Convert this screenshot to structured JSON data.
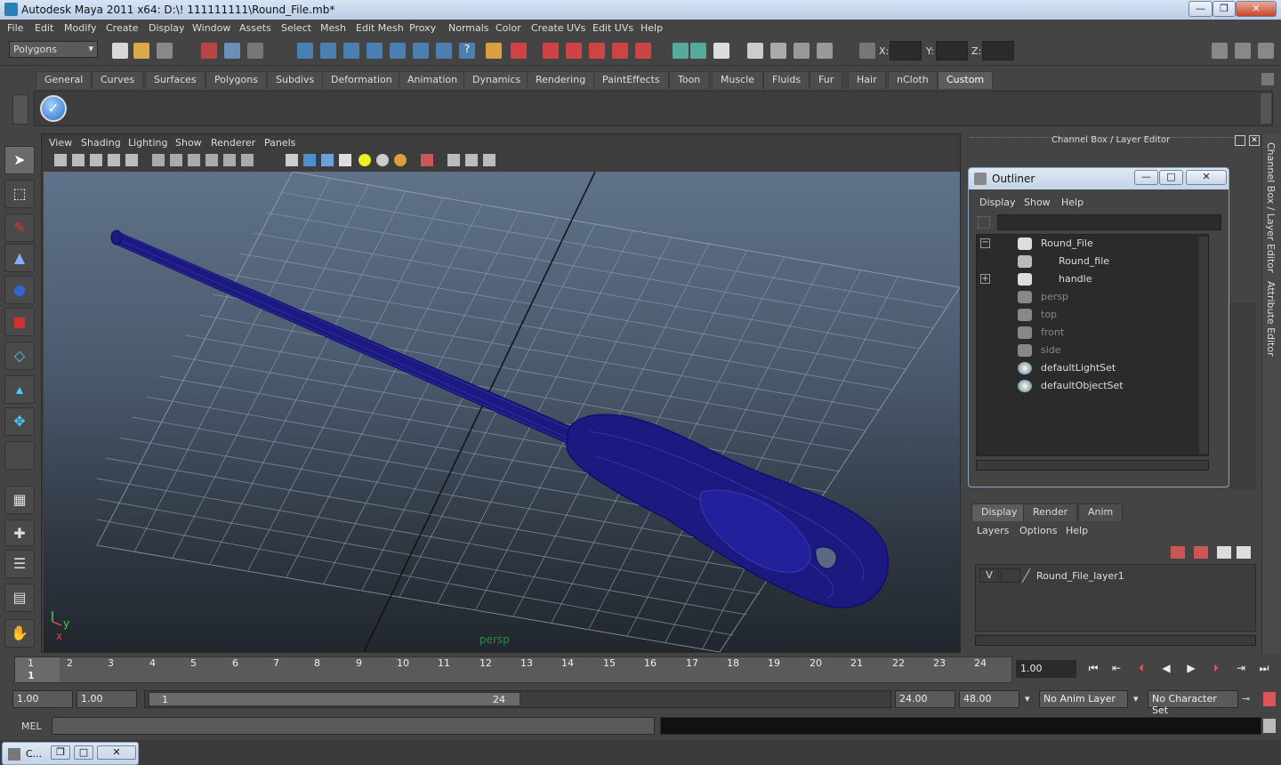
{
  "window": {
    "title": "Autodesk Maya 2011 x64: D:\\! 111111111\\Round_File.mb*",
    "minimize": "—",
    "maximize": "❐",
    "close": "✕"
  },
  "menubar": [
    "File",
    "Edit",
    "Modify",
    "Create",
    "Display",
    "Window",
    "Assets",
    "Select",
    "Mesh",
    "Edit Mesh",
    "Proxy",
    "Normals",
    "Color",
    "Create UVs",
    "Edit UVs",
    "Help"
  ],
  "status": {
    "mode": "Polygons",
    "x_label": "X:",
    "y_label": "Y:",
    "z_label": "Z:"
  },
  "shelf": {
    "tabs": [
      "General",
      "Curves",
      "Surfaces",
      "Polygons",
      "Subdivs",
      "Deformation",
      "Animation",
      "Dynamics",
      "Rendering",
      "PaintEffects",
      "Toon",
      "Muscle",
      "Fluids",
      "Fur",
      "Hair",
      "nCloth",
      "Custom"
    ],
    "active": "Custom"
  },
  "viewport": {
    "menus": [
      "View",
      "Shading",
      "Lighting",
      "Show",
      "Renderer",
      "Panels"
    ],
    "camera_label": "persp",
    "axis_y": "y",
    "axis_x": "x"
  },
  "channel_box": {
    "title": "Channel Box / Layer Editor"
  },
  "side_tabs": {
    "channel": "Channel Box / Layer Editor",
    "attr": "Attribute Editor"
  },
  "outliner": {
    "title": "Outliner",
    "menus": [
      "Display",
      "Show",
      "Help"
    ],
    "items": [
      {
        "label": "Round_File"
      },
      {
        "label": "Round_file"
      },
      {
        "label": "handle"
      },
      {
        "label": "persp"
      },
      {
        "label": "top"
      },
      {
        "label": "front"
      },
      {
        "label": "side"
      },
      {
        "label": "defaultLightSet"
      },
      {
        "label": "defaultObjectSet"
      }
    ]
  },
  "layer_editor": {
    "tabs": [
      "Display",
      "Render",
      "Anim"
    ],
    "menus": [
      "Layers",
      "Options",
      "Help"
    ],
    "layer": {
      "visible": "V",
      "name": "Round_File_layer1"
    }
  },
  "timeline": {
    "ticks": [
      "1",
      "2",
      "3",
      "4",
      "5",
      "6",
      "7",
      "8",
      "9",
      "10",
      "11",
      "12",
      "13",
      "14",
      "15",
      "16",
      "17",
      "18",
      "19",
      "20",
      "21",
      "22",
      "23",
      "24"
    ],
    "current_marker": "1",
    "current_frame": "1.00"
  },
  "range": {
    "start": "1.00",
    "start2": "1.00",
    "slider_start": "1",
    "slider_end": "24",
    "end": "24.00",
    "end2": "48.00",
    "anim_layer": "No Anim Layer",
    "char_set": "No Character Set"
  },
  "cmd": {
    "label": "MEL"
  },
  "taskbar": {
    "item": "C..."
  }
}
